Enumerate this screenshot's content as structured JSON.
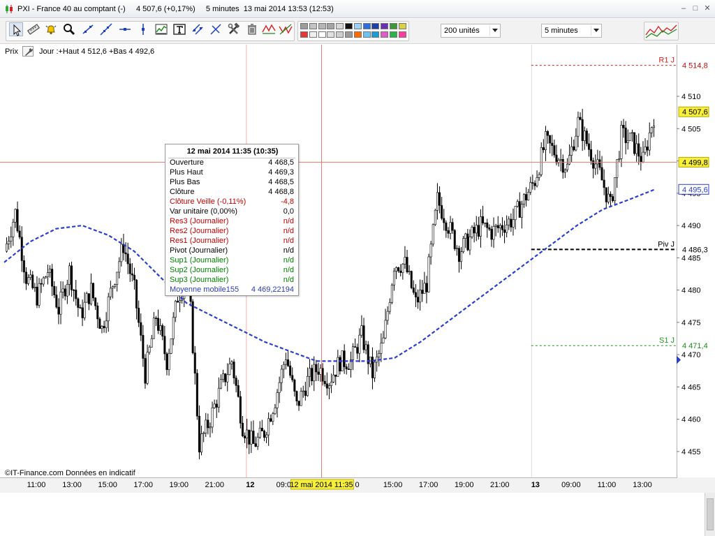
{
  "window": {
    "title": "PXI - France 40 au comptant (-)     4 507,6 (+0,17%)     5 minutes  13 mai 2014 13:53 (12:53)",
    "min_glyph": "–",
    "max_glyph": "□",
    "close_glyph": "✕"
  },
  "toolbar": {
    "tools": [
      "pointer",
      "ruler",
      "alert-bell",
      "zoom",
      "trend-line",
      "segment",
      "horizontal-line",
      "vertical-line",
      "indicator",
      "text",
      "channel",
      "fibonacci",
      "tools",
      "delete",
      "wave-triangles",
      "remove-wave"
    ],
    "swatches_top": [
      "#9c9c9c",
      "#c3c3c3",
      "#b6b6b6",
      "#a5a5a5",
      "#d7d7d7",
      "#111111",
      "#9cd0f7",
      "#2a6fdb",
      "#1e3fa8",
      "#6b2fb4",
      "#3a9a3a",
      "#d9d04a"
    ],
    "swatches_bottom": [
      "#e53935",
      "#f0f0f0",
      "#ffffff",
      "#e0e0e0",
      "#cfcfcf",
      "#9a9a9a",
      "#ff6a00",
      "#6cc3f0",
      "#1d9bd6",
      "#e05cc8",
      "#2bb34a",
      "#ff3aa0"
    ],
    "units_select": {
      "value": "200 unités"
    },
    "period_select": {
      "value": "5 minutes"
    }
  },
  "legend": {
    "price_label": "Prix",
    "daily_info": "Jour :+Haut 4 512,6 +Bas 4 492,6"
  },
  "tooltip": {
    "title": "12 mai 2014 11:35 (10:35)",
    "rows": [
      {
        "label": "Ouverture",
        "value": "4 468,5",
        "color": "#000000"
      },
      {
        "label": "Plus Haut",
        "value": "4 469,3",
        "color": "#000000"
      },
      {
        "label": "Plus Bas",
        "value": "4 468,5",
        "color": "#000000"
      },
      {
        "label": "Clôture",
        "value": "4 468,8",
        "color": "#000000"
      },
      {
        "label": "Clôture Veille (-0,11%)",
        "value": "-4,8",
        "color": "#c00000"
      },
      {
        "label": "Var unitaire (0,00%)",
        "value": "0,0",
        "color": "#000000"
      },
      {
        "label": "Res3 (Journalier)",
        "value": "n/d",
        "color": "#c00000"
      },
      {
        "label": "Res2 (Journalier)",
        "value": "n/d",
        "color": "#c00000"
      },
      {
        "label": "Res1 (Journalier)",
        "value": "n/d",
        "color": "#c00000"
      },
      {
        "label": "Pivot (Journalier)",
        "value": "n/d",
        "color": "#000000"
      },
      {
        "label": "Sup1 (Journalier)",
        "value": "n/d",
        "color": "#008000"
      },
      {
        "label": "Sup2 (Journalier)",
        "value": "n/d",
        "color": "#008000"
      },
      {
        "label": "Sup3 (Journalier)",
        "value": "n/d",
        "color": "#008000"
      },
      {
        "label": "Moyenne mobile155",
        "value": "4 469,22194",
        "color": "#2b3bb0"
      }
    ]
  },
  "chart_data": {
    "type": "candlestick",
    "instrument": "PXI - France 40 au comptant",
    "period": "5 minutes",
    "y_range": [
      4451,
      4518
    ],
    "y_ticks": [
      {
        "value": 4455,
        "label": "4 455"
      },
      {
        "value": 4460,
        "label": "4 460"
      },
      {
        "value": 4465,
        "label": "4 465"
      },
      {
        "value": 4470,
        "label": "4 470"
      },
      {
        "value": 4475,
        "label": "4 475"
      },
      {
        "value": 4480,
        "label": "4 480"
      },
      {
        "value": 4485,
        "label": "4 485"
      },
      {
        "value": 4490,
        "label": "4 490"
      },
      {
        "value": 4495,
        "label": "4 495"
      },
      {
        "value": 4500,
        "label": "4 500"
      },
      {
        "value": 4505,
        "label": "4 505"
      },
      {
        "value": 4510,
        "label": "4 510"
      }
    ],
    "x_labels": [
      {
        "label": "11:00",
        "bold": false,
        "highlight": false
      },
      {
        "label": "13:00",
        "bold": false,
        "highlight": false
      },
      {
        "label": "15:00",
        "bold": false,
        "highlight": false
      },
      {
        "label": "17:00",
        "bold": false,
        "highlight": false
      },
      {
        "label": "19:00",
        "bold": false,
        "highlight": false
      },
      {
        "label": "21:00",
        "bold": false,
        "highlight": false
      },
      {
        "label": "12",
        "bold": true,
        "highlight": false
      },
      {
        "label": "09:00",
        "bold": false,
        "highlight": false
      },
      {
        "label": "12 mai 2014 11:35",
        "bold": false,
        "highlight": true
      },
      {
        "label": "0",
        "bold": false,
        "highlight": false
      },
      {
        "label": "15:00",
        "bold": false,
        "highlight": false
      },
      {
        "label": "17:00",
        "bold": false,
        "highlight": false
      },
      {
        "label": "19:00",
        "bold": false,
        "highlight": false
      },
      {
        "label": "21:00",
        "bold": false,
        "highlight": false
      },
      {
        "label": "13",
        "bold": true,
        "highlight": false
      },
      {
        "label": "09:00",
        "bold": false,
        "highlight": false
      },
      {
        "label": "11:00",
        "bold": false,
        "highlight": false
      },
      {
        "label": "13:00",
        "bold": false,
        "highlight": false
      }
    ],
    "badges": [
      {
        "value": 4514.8,
        "label": "4 514,8",
        "style": "red"
      },
      {
        "value": 4507.6,
        "label": "4 507,6",
        "style": "yellow"
      },
      {
        "value": 4499.8,
        "label": "4 499,8",
        "style": "yellow"
      },
      {
        "value": 4495.6,
        "label": "4 495,6",
        "style": "blue"
      },
      {
        "value": 4486.3,
        "label": "4 486,3",
        "style": "black"
      },
      {
        "value": 4471.4,
        "label": "4 471,4",
        "style": "green"
      }
    ],
    "levels": [
      {
        "name": "R1 J",
        "label": "R1 J",
        "value": 4514.8,
        "color": "#d02020",
        "dash": "3,3",
        "from": "day3"
      },
      {
        "name": "Piv J",
        "label": "Piv J",
        "value": 4486.3,
        "color": "#000000",
        "dash": "5,3",
        "from": "day3"
      },
      {
        "name": "S1 J",
        "label": "S1 J",
        "value": 4471.4,
        "color": "#1a9a1a",
        "dash": "3,3",
        "from": "day3"
      }
    ],
    "crosshair_price": 4499.8,
    "moving_average": {
      "name": "Moyenne mobile155",
      "color": "#2a3fd0",
      "points": [
        [
          4484.3,
          4487.5,
          4489.5,
          4490,
          4488.5,
          4486,
          4482,
          4478,
          4476,
          4474,
          4472,
          4470.5,
          4469,
          4469,
          4469,
          4469.5,
          4472,
          4475,
          4478,
          4481,
          4484,
          4487,
          4490,
          4492.5,
          4494,
          4495.6
        ]
      ]
    },
    "watermark": "©IT-Finance.com  Données en indicatif",
    "price_path": [
      4486,
      4492,
      4482,
      4479,
      4483,
      4477,
      4483,
      4476,
      4480,
      4474,
      4481,
      4487,
      4480,
      4467,
      4476,
      4469,
      4479,
      4482,
      4456,
      4460,
      4465,
      4469,
      4459,
      4456,
      4458,
      4463,
      4470,
      4462,
      4466,
      4468,
      4466,
      4469,
      4469,
      4473,
      4467,
      4472,
      4484,
      4484,
      4478,
      4481,
      4494,
      4490,
      4486,
      4488,
      4490,
      4489,
      4490,
      4491,
      4494,
      4497,
      4503,
      4501,
      4499,
      4506,
      4502,
      4498,
      4493,
      4504,
      4503,
      4500,
      4507
    ]
  }
}
